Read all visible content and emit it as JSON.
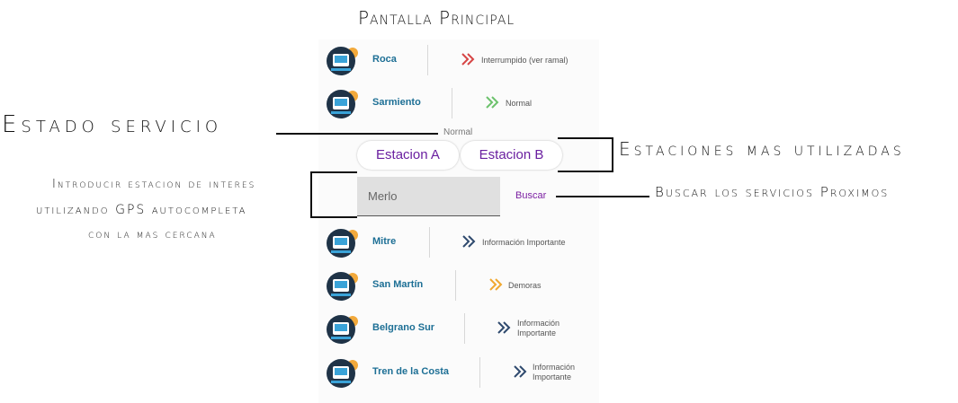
{
  "title": "Pantalla Principal",
  "annotations": {
    "estado_servicio": "Estado servicio",
    "estaciones": "Estaciones mas utilizadas",
    "introducir_l1": "Introducir estacion de interes",
    "introducir_l2": "utilizando GPS autocompleta",
    "introducir_l3": "con la mas cercana",
    "buscar_servicios": "Buscar los servicios Proximos"
  },
  "top_lines": [
    {
      "name": "Roca",
      "status": "Interrumpido (ver ramal)",
      "status_color": "#d64545"
    },
    {
      "name": "Sarmiento",
      "status": "Normal",
      "status_color": "#6cc26c"
    }
  ],
  "normal_label": "Normal",
  "chips": [
    "Estacion A",
    "Estacion B"
  ],
  "search": {
    "value": "Merlo",
    "button": "Buscar"
  },
  "bottom_lines": [
    {
      "name": "Mitre",
      "status": "Información Importante",
      "status_color": "#2f4a6e"
    },
    {
      "name": "San Martín",
      "status": "Demoras",
      "status_color": "#f0a830"
    },
    {
      "name": "Belgrano Sur",
      "status_l1": "Información",
      "status_l2": "Importante",
      "status_color": "#2f4a6e"
    },
    {
      "name": "Tren de la Costa",
      "status_l1": "Información",
      "status_l2": "Importante",
      "status_color": "#2f4a6e"
    }
  ]
}
